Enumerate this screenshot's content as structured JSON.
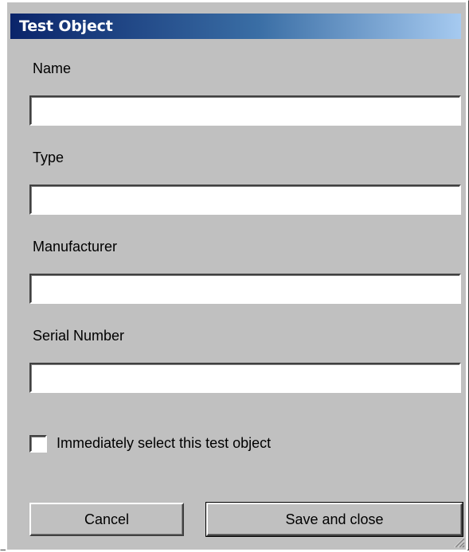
{
  "window": {
    "title": "Test Object"
  },
  "form": {
    "fields": [
      {
        "label": "Name",
        "value": ""
      },
      {
        "label": "Type",
        "value": ""
      },
      {
        "label": "Manufacturer",
        "value": ""
      },
      {
        "label": "Serial Number",
        "value": ""
      }
    ],
    "checkbox": {
      "label": "Immediately select this test object",
      "checked": false
    }
  },
  "buttons": {
    "cancel_label": "Cancel",
    "save_label": "Save and close"
  },
  "icons": {
    "resize_grip": "resize-grip-icon"
  },
  "colors": {
    "titlebar_start": "#0a246a",
    "titlebar_end": "#a6caf0",
    "panel_bg": "#c0c0c0"
  }
}
